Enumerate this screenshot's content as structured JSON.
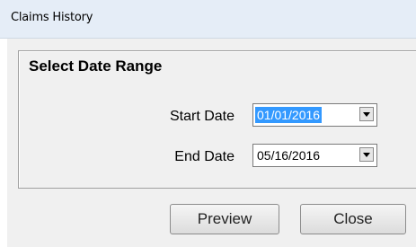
{
  "window": {
    "title": "Claims History"
  },
  "group": {
    "title": "Select Date Range"
  },
  "start_date": {
    "label": "Start Date",
    "value": "01/01/2016",
    "selected": true
  },
  "end_date": {
    "label": "End Date",
    "value": "05/16/2016",
    "selected": false
  },
  "buttons": {
    "preview_label": "Preview",
    "close_label": "Close"
  },
  "icons": {
    "dropdown": "chevron-down-icon"
  },
  "colors": {
    "selection": "#3399ff",
    "titlebar": "#e5edf7",
    "client": "#f0f0f0"
  }
}
